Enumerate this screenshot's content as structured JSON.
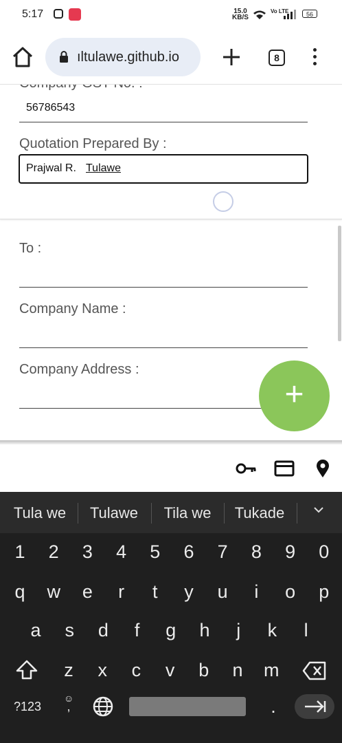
{
  "status_bar": {
    "time": "5:17",
    "speed": "15.0\nKB/S",
    "network": "Vo LTE",
    "battery": "56"
  },
  "browser": {
    "url": "ıltulawe.github.io",
    "tab_count": "8"
  },
  "form": {
    "gst_label": "Company GST No. :",
    "gst_value": "56786543",
    "prepared_by_label": "Quotation Prepared By :",
    "prepared_by_first": "Prajwal R. ",
    "prepared_by_last": "Tulawe",
    "to_label": "To :",
    "company_name_label": "Company Name :",
    "company_address_label": "Company Address :",
    "fab_label": "+"
  },
  "keyboard": {
    "suggestions": [
      "Tula we",
      "Tulawe",
      "Tila we",
      "Tukade"
    ],
    "row_numbers": [
      "1",
      "2",
      "3",
      "4",
      "5",
      "6",
      "7",
      "8",
      "9",
      "0"
    ],
    "row1": [
      "q",
      "w",
      "e",
      "r",
      "t",
      "y",
      "u",
      "i",
      "o",
      "p"
    ],
    "row2": [
      "a",
      "s",
      "d",
      "f",
      "g",
      "h",
      "j",
      "k",
      "l"
    ],
    "row3": [
      "z",
      "x",
      "c",
      "v",
      "b",
      "n",
      "m"
    ],
    "symbols_key": "?123",
    "comma_key": ",",
    "period_key": "."
  },
  "colors": {
    "fab": "#8bc65a",
    "url_pill": "#e8edf6",
    "keyboard_bg": "#1f1f1f"
  }
}
